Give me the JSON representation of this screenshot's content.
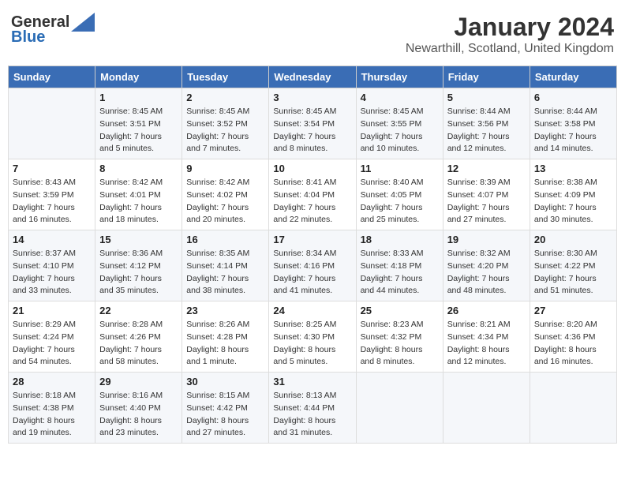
{
  "header": {
    "logo_general": "General",
    "logo_blue": "Blue",
    "month": "January 2024",
    "location": "Newarthill, Scotland, United Kingdom"
  },
  "days_of_week": [
    "Sunday",
    "Monday",
    "Tuesday",
    "Wednesday",
    "Thursday",
    "Friday",
    "Saturday"
  ],
  "weeks": [
    [
      {
        "day": "",
        "info": []
      },
      {
        "day": "1",
        "info": [
          "Sunrise: 8:45 AM",
          "Sunset: 3:51 PM",
          "Daylight: 7 hours",
          "and 5 minutes."
        ]
      },
      {
        "day": "2",
        "info": [
          "Sunrise: 8:45 AM",
          "Sunset: 3:52 PM",
          "Daylight: 7 hours",
          "and 7 minutes."
        ]
      },
      {
        "day": "3",
        "info": [
          "Sunrise: 8:45 AM",
          "Sunset: 3:54 PM",
          "Daylight: 7 hours",
          "and 8 minutes."
        ]
      },
      {
        "day": "4",
        "info": [
          "Sunrise: 8:45 AM",
          "Sunset: 3:55 PM",
          "Daylight: 7 hours",
          "and 10 minutes."
        ]
      },
      {
        "day": "5",
        "info": [
          "Sunrise: 8:44 AM",
          "Sunset: 3:56 PM",
          "Daylight: 7 hours",
          "and 12 minutes."
        ]
      },
      {
        "day": "6",
        "info": [
          "Sunrise: 8:44 AM",
          "Sunset: 3:58 PM",
          "Daylight: 7 hours",
          "and 14 minutes."
        ]
      }
    ],
    [
      {
        "day": "7",
        "info": [
          "Sunrise: 8:43 AM",
          "Sunset: 3:59 PM",
          "Daylight: 7 hours",
          "and 16 minutes."
        ]
      },
      {
        "day": "8",
        "info": [
          "Sunrise: 8:42 AM",
          "Sunset: 4:01 PM",
          "Daylight: 7 hours",
          "and 18 minutes."
        ]
      },
      {
        "day": "9",
        "info": [
          "Sunrise: 8:42 AM",
          "Sunset: 4:02 PM",
          "Daylight: 7 hours",
          "and 20 minutes."
        ]
      },
      {
        "day": "10",
        "info": [
          "Sunrise: 8:41 AM",
          "Sunset: 4:04 PM",
          "Daylight: 7 hours",
          "and 22 minutes."
        ]
      },
      {
        "day": "11",
        "info": [
          "Sunrise: 8:40 AM",
          "Sunset: 4:05 PM",
          "Daylight: 7 hours",
          "and 25 minutes."
        ]
      },
      {
        "day": "12",
        "info": [
          "Sunrise: 8:39 AM",
          "Sunset: 4:07 PM",
          "Daylight: 7 hours",
          "and 27 minutes."
        ]
      },
      {
        "day": "13",
        "info": [
          "Sunrise: 8:38 AM",
          "Sunset: 4:09 PM",
          "Daylight: 7 hours",
          "and 30 minutes."
        ]
      }
    ],
    [
      {
        "day": "14",
        "info": [
          "Sunrise: 8:37 AM",
          "Sunset: 4:10 PM",
          "Daylight: 7 hours",
          "and 33 minutes."
        ]
      },
      {
        "day": "15",
        "info": [
          "Sunrise: 8:36 AM",
          "Sunset: 4:12 PM",
          "Daylight: 7 hours",
          "and 35 minutes."
        ]
      },
      {
        "day": "16",
        "info": [
          "Sunrise: 8:35 AM",
          "Sunset: 4:14 PM",
          "Daylight: 7 hours",
          "and 38 minutes."
        ]
      },
      {
        "day": "17",
        "info": [
          "Sunrise: 8:34 AM",
          "Sunset: 4:16 PM",
          "Daylight: 7 hours",
          "and 41 minutes."
        ]
      },
      {
        "day": "18",
        "info": [
          "Sunrise: 8:33 AM",
          "Sunset: 4:18 PM",
          "Daylight: 7 hours",
          "and 44 minutes."
        ]
      },
      {
        "day": "19",
        "info": [
          "Sunrise: 8:32 AM",
          "Sunset: 4:20 PM",
          "Daylight: 7 hours",
          "and 48 minutes."
        ]
      },
      {
        "day": "20",
        "info": [
          "Sunrise: 8:30 AM",
          "Sunset: 4:22 PM",
          "Daylight: 7 hours",
          "and 51 minutes."
        ]
      }
    ],
    [
      {
        "day": "21",
        "info": [
          "Sunrise: 8:29 AM",
          "Sunset: 4:24 PM",
          "Daylight: 7 hours",
          "and 54 minutes."
        ]
      },
      {
        "day": "22",
        "info": [
          "Sunrise: 8:28 AM",
          "Sunset: 4:26 PM",
          "Daylight: 7 hours",
          "and 58 minutes."
        ]
      },
      {
        "day": "23",
        "info": [
          "Sunrise: 8:26 AM",
          "Sunset: 4:28 PM",
          "Daylight: 8 hours",
          "and 1 minute."
        ]
      },
      {
        "day": "24",
        "info": [
          "Sunrise: 8:25 AM",
          "Sunset: 4:30 PM",
          "Daylight: 8 hours",
          "and 5 minutes."
        ]
      },
      {
        "day": "25",
        "info": [
          "Sunrise: 8:23 AM",
          "Sunset: 4:32 PM",
          "Daylight: 8 hours",
          "and 8 minutes."
        ]
      },
      {
        "day": "26",
        "info": [
          "Sunrise: 8:21 AM",
          "Sunset: 4:34 PM",
          "Daylight: 8 hours",
          "and 12 minutes."
        ]
      },
      {
        "day": "27",
        "info": [
          "Sunrise: 8:20 AM",
          "Sunset: 4:36 PM",
          "Daylight: 8 hours",
          "and 16 minutes."
        ]
      }
    ],
    [
      {
        "day": "28",
        "info": [
          "Sunrise: 8:18 AM",
          "Sunset: 4:38 PM",
          "Daylight: 8 hours",
          "and 19 minutes."
        ]
      },
      {
        "day": "29",
        "info": [
          "Sunrise: 8:16 AM",
          "Sunset: 4:40 PM",
          "Daylight: 8 hours",
          "and 23 minutes."
        ]
      },
      {
        "day": "30",
        "info": [
          "Sunrise: 8:15 AM",
          "Sunset: 4:42 PM",
          "Daylight: 8 hours",
          "and 27 minutes."
        ]
      },
      {
        "day": "31",
        "info": [
          "Sunrise: 8:13 AM",
          "Sunset: 4:44 PM",
          "Daylight: 8 hours",
          "and 31 minutes."
        ]
      },
      {
        "day": "",
        "info": []
      },
      {
        "day": "",
        "info": []
      },
      {
        "day": "",
        "info": []
      }
    ]
  ]
}
